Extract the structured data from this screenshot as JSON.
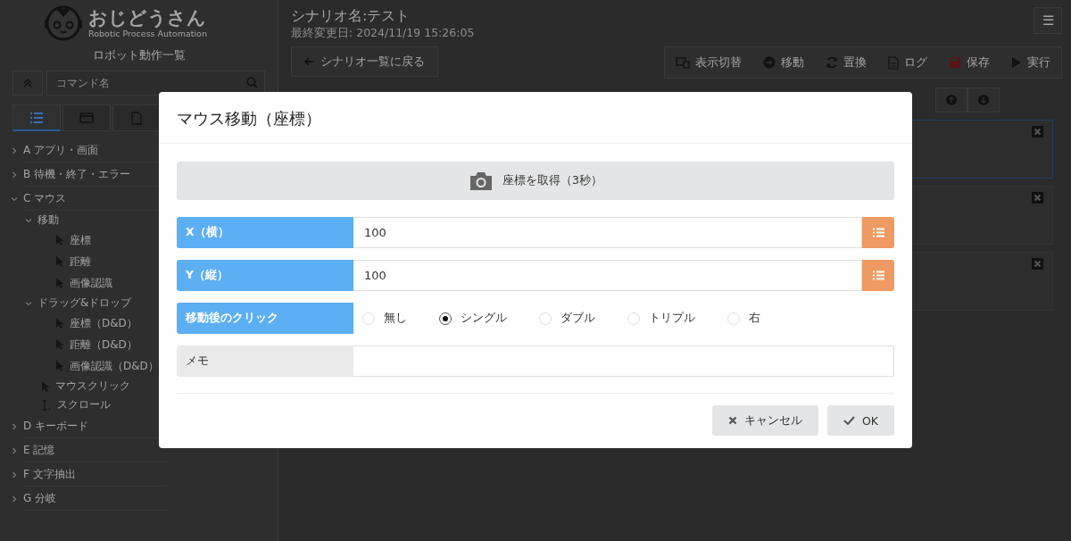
{
  "app": {
    "logo_title": "おじどうさん",
    "logo_subtitle": "Robotic Process Automation",
    "menu_icon": "☰"
  },
  "scenario": {
    "title": "シナリオ名:テスト",
    "modified": "最終変更日: 2024/11/19 15:26:05"
  },
  "sidebar": {
    "title": "ロボット動作一覧",
    "search": {
      "placeholder": "コマンド名"
    },
    "tabs": [
      {
        "kind": "list",
        "selected": true
      },
      {
        "kind": "card",
        "selected": false
      },
      {
        "kind": "file",
        "selected": false
      }
    ],
    "tree": [
      {
        "letter": "A",
        "label": "アプリ・画面",
        "expanded": false
      },
      {
        "letter": "B",
        "label": "待機・終了・エラー",
        "expanded": false
      },
      {
        "letter": "C",
        "label": "マウス",
        "expanded": true,
        "children": [
          {
            "label": "移動",
            "expanded": true,
            "children": [
              {
                "label": "座標",
                "kind": "pointer"
              },
              {
                "label": "距離",
                "kind": "pointer"
              },
              {
                "label": "画像認識",
                "kind": "pointer"
              }
            ]
          },
          {
            "label": "ドラッグ&ドロップ",
            "expanded": true,
            "children": [
              {
                "label": "座標（D&D）",
                "kind": "pointer"
              },
              {
                "label": "距離（D&D）",
                "kind": "pointer"
              },
              {
                "label": "画像認識（D&D）",
                "kind": "pointer"
              }
            ]
          },
          {
            "label": "マウスクリック",
            "kind": "pointer"
          },
          {
            "label": "スクロール",
            "kind": "scroll"
          }
        ]
      },
      {
        "letter": "D",
        "label": "キーボード",
        "expanded": false
      },
      {
        "letter": "E",
        "label": "記憶",
        "expanded": false
      },
      {
        "letter": "F",
        "label": "文字抽出",
        "expanded": false
      },
      {
        "letter": "G",
        "label": "分岐",
        "expanded": false
      }
    ]
  },
  "toolbar": {
    "back": "シナリオ一覧に戻る",
    "buttons": [
      {
        "kind": "display",
        "label": "表示切替"
      },
      {
        "kind": "move",
        "label": "移動"
      },
      {
        "kind": "replace",
        "label": "置換"
      },
      {
        "kind": "log",
        "label": "ログ"
      },
      {
        "kind": "save",
        "label": "保存"
      },
      {
        "kind": "run",
        "label": "実行"
      }
    ]
  },
  "steps": [
    {
      "selected": true
    },
    {
      "selected": false
    },
    {
      "selected": false
    }
  ],
  "dialog": {
    "title": "マウス移動（座標）",
    "capture": "座標を取得（3秒）",
    "fields": [
      {
        "label": "X（横）",
        "value": "100"
      },
      {
        "label": "Y（縦）",
        "value": "100"
      }
    ],
    "click": {
      "label": "移動後のクリック",
      "options": [
        {
          "label": "無し",
          "selected": false
        },
        {
          "label": "シングル",
          "selected": true
        },
        {
          "label": "ダブル",
          "selected": false
        },
        {
          "label": "トリプル",
          "selected": false
        },
        {
          "label": "右",
          "selected": false
        }
      ]
    },
    "memo": {
      "label": "メモ"
    },
    "cancel": "キャンセル",
    "ok": "OK"
  }
}
